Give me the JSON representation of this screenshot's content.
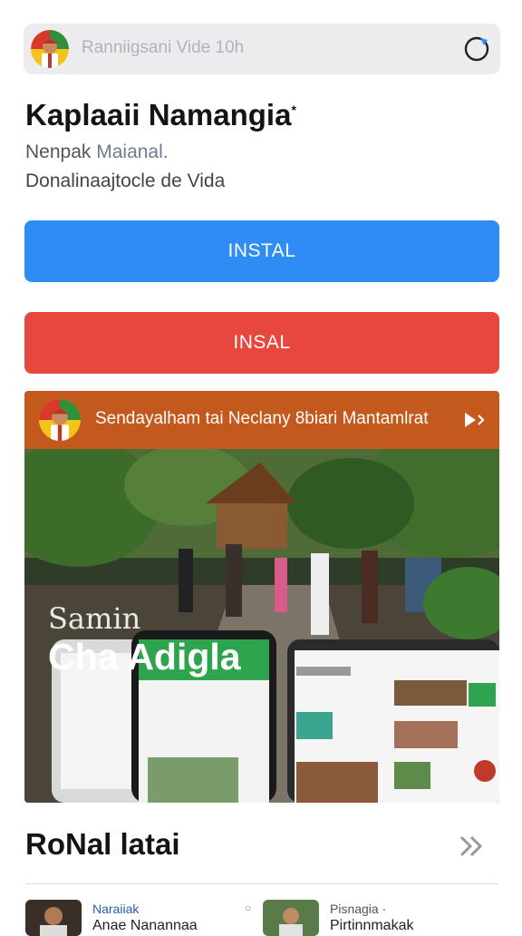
{
  "header": {
    "title": "Ranniigsani Vide 10h"
  },
  "app": {
    "name": "Kaplaaii Namangia",
    "name_mark": "*",
    "subtitle_plain": "Nenpak",
    "subtitle_accent": "Maianal.",
    "description": "Donalinaajtocle de Vida"
  },
  "buttons": {
    "primary_label": "INSTAL",
    "secondary_label": "INSAL"
  },
  "banner": {
    "header_text": "Sendayalham tai Neclany 8biari Mantamlrat",
    "overlay_small": "Samin",
    "overlay_big": "Cha Adigla"
  },
  "section": {
    "title": "RoNal latai"
  },
  "cards": [
    {
      "meta": "Naraiiak",
      "title": "Anae Nanannaa"
    },
    {
      "meta": "Pisnagia ·",
      "title": "Pirtinnmakak"
    }
  ],
  "colors": {
    "primary": "#2f8cf5",
    "danger": "#e8473f",
    "banner_header": "#c4591d"
  },
  "icons": {
    "top_right": "refresh-icon",
    "banner_arrow": "play-arrow-icon",
    "section": "double-chevron-icon"
  }
}
